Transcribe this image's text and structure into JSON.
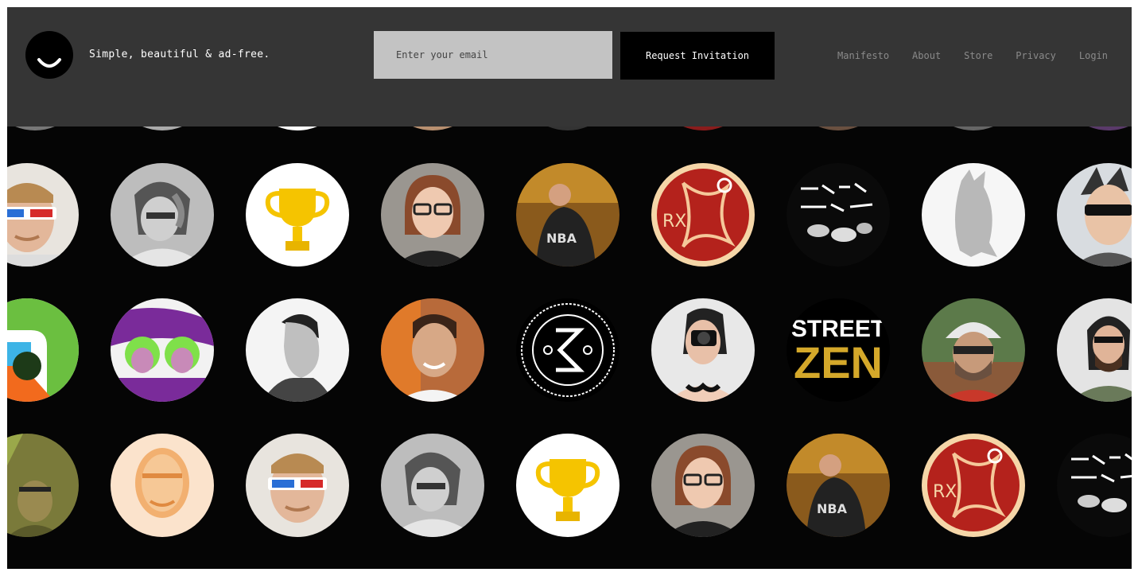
{
  "header": {
    "tagline": "Simple, beautiful & ad-free.",
    "email_placeholder": "Enter your email",
    "request_button": "Request Invitation",
    "nav": [
      "Manifesto",
      "About",
      "Store",
      "Privacy",
      "Login"
    ]
  },
  "avatars": {
    "colors": {
      "frame_bg": "#050505",
      "header_bg": "#353535",
      "email_bg": "#c3c3c3"
    },
    "row1": [
      "man-3d-glasses",
      "woman-bw",
      "trophy",
      "woman-glasses",
      "man-nba-jacket",
      "rx-red-skull",
      "scribble-art",
      "bear-sketch",
      "man-sunglasses"
    ],
    "row2": [
      "colorful-logo",
      "pink-girls-illustration",
      "man-profile-bw",
      "man-smiling",
      "stamp-badge",
      "woman-camera",
      "street-zen",
      "man-cap",
      "man-beard-glasses"
    ],
    "row3": [
      "man-green-cave",
      "man-orange-halftone",
      "man-3d-glasses",
      "woman-bw",
      "trophy",
      "woman-glasses",
      "man-nba-jacket",
      "rx-red-skull",
      "scribble-art"
    ],
    "labels": {
      "street": "STREET",
      "zen": "ZEN",
      "rx": "RX",
      "nba": "NBA"
    }
  }
}
